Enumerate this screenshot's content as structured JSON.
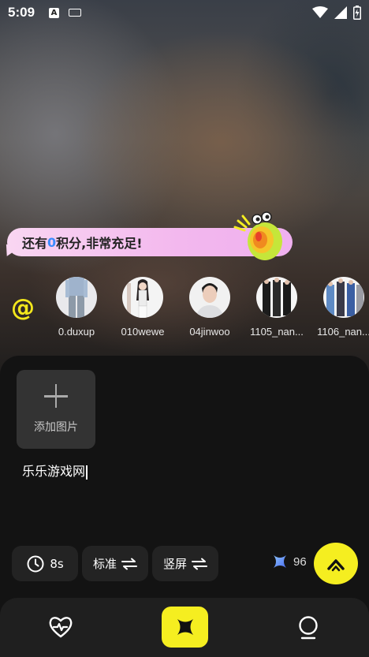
{
  "status_bar": {
    "time": "5:09",
    "input_badge": "A"
  },
  "credits_bubble": {
    "text_before": "还有",
    "points": "0",
    "text_after": "积分,非常充足!"
  },
  "mention_symbol": "@",
  "avatars": [
    {
      "label": "0.duxup"
    },
    {
      "label": "010wewe"
    },
    {
      "label": "04jinwoo"
    },
    {
      "label": "1105_nan..."
    },
    {
      "label": "1106_nan..."
    }
  ],
  "add_image": {
    "label": "添加图片"
  },
  "prompt": {
    "text": "乐乐游戏网"
  },
  "options": {
    "duration": "8s",
    "quality": "标准",
    "orientation": "竖屏"
  },
  "credits_balance": "96",
  "colors": {
    "accent_yellow": "#f5ee20",
    "points_blue": "#3c8cff",
    "bubble_pink": "#f3b8ee",
    "panel_bg": "#131313"
  },
  "icons": {
    "duration": "clock-icon",
    "swap": "swap-arrows-icon",
    "credits": "sparkle-icon",
    "submit": "chevron-up-icon",
    "nav_left": "heart-pulse-icon",
    "nav_center": "sparkle-icon",
    "nav_right": "bulb-icon"
  }
}
